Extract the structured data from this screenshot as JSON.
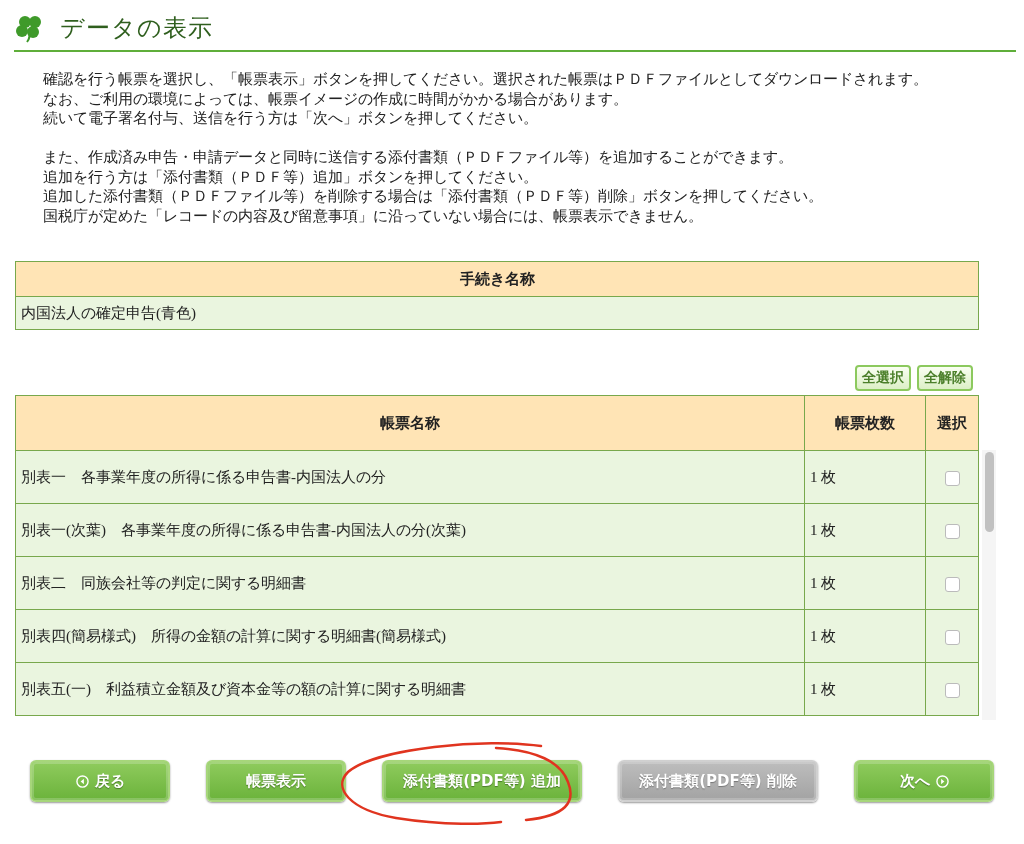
{
  "title": "データの表示",
  "instructions": [
    [
      "確認を行う帳票を選択し、「帳票表示」ボタンを押してください。選択された帳票はＰＤＦファイルとしてダウンロードされます。",
      "なお、ご利用の環境によっては、帳票イメージの作成に時間がかかる場合があります。",
      "続いて電子署名付与、送信を行う方は「次へ」ボタンを押してください。"
    ],
    [
      "また、作成済み申告・申請データと同時に送信する添付書類（ＰＤＦファイル等）を追加することができます。",
      "追加を行う方は「添付書類（ＰＤＦ等）追加」ボタンを押してください。",
      "追加した添付書類（ＰＤＦファイル等）を削除する場合は「添付書類（ＰＤＦ等）削除」ボタンを押してください。",
      "国税庁が定めた「レコードの内容及び留意事項」に沿っていない場合には、帳票表示できません。"
    ]
  ],
  "procedure_table": {
    "header": "手続き名称",
    "value": "内国法人の確定申告(青色)"
  },
  "select_buttons": [
    {
      "label": "全選択"
    },
    {
      "label": "全解除"
    }
  ],
  "forms_table": {
    "columns": [
      "帳票名称",
      "帳票枚数",
      "選択"
    ],
    "rows": [
      {
        "name": "別表一　各事業年度の所得に係る申告書-内国法人の分",
        "count": "1 枚",
        "checked": false
      },
      {
        "name": "別表一(次葉)　各事業年度の所得に係る申告書-内国法人の分(次葉)",
        "count": "1 枚",
        "checked": false
      },
      {
        "name": "別表二　同族会社等の判定に関する明細書",
        "count": "1 枚",
        "checked": false
      },
      {
        "name": "別表四(簡易様式)　所得の金額の計算に関する明細書(簡易様式)",
        "count": "1 枚",
        "checked": false
      },
      {
        "name": "別表五(一)　利益積立金額及び資本金等の額の計算に関する明細書",
        "count": "1 枚",
        "checked": false
      }
    ]
  },
  "buttons": [
    {
      "label": "戻る",
      "kind": "back",
      "disabled": false
    },
    {
      "label": "帳票表示",
      "kind": "plain",
      "disabled": false
    },
    {
      "label": "添付書類(PDF等) 追加",
      "kind": "plain",
      "disabled": false
    },
    {
      "label": "添付書類(PDF等) 削除",
      "kind": "plain",
      "disabled": true
    },
    {
      "label": "次へ",
      "kind": "next",
      "disabled": false
    }
  ]
}
